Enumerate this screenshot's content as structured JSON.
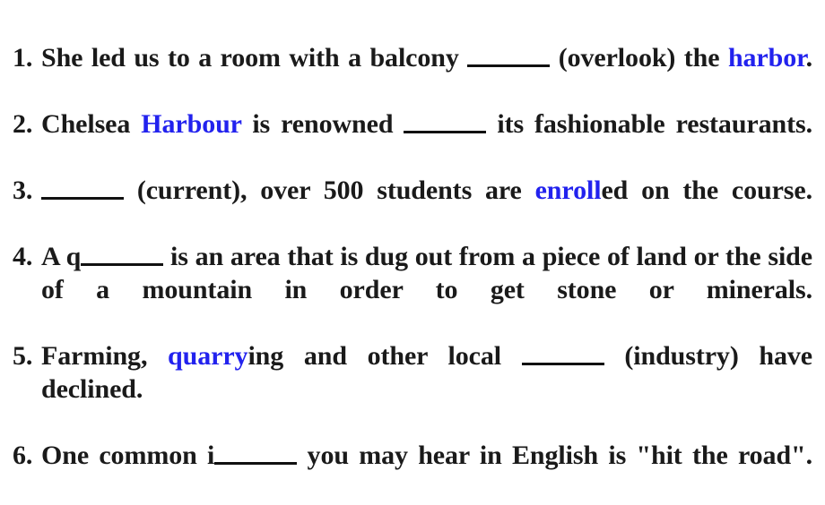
{
  "document": {
    "type": "fill-in-the-blank-worksheet",
    "accent_color": "#2222ee",
    "text_color": "#1a1a1a",
    "background_color": "#ffffff",
    "exercises": [
      {
        "number": "1.",
        "parts": [
          {
            "text": "She led us to a room with a balcony ",
            "style": "normal"
          },
          {
            "text": "",
            "style": "blank"
          },
          {
            "text": " (overlook) the ",
            "style": "normal"
          },
          {
            "text": "harbor",
            "style": "highlight"
          },
          {
            "text": ".",
            "style": "normal"
          }
        ],
        "plain_text": "She led us to a room with a balcony ______ (overlook) the harbor."
      },
      {
        "number": "2.",
        "parts": [
          {
            "text": "Chelsea ",
            "style": "normal"
          },
          {
            "text": "Harbour",
            "style": "highlight"
          },
          {
            "text": " is renowned ",
            "style": "normal"
          },
          {
            "text": "",
            "style": "blank"
          },
          {
            "text": " its fashionable restaurants.",
            "style": "normal"
          }
        ],
        "plain_text": "Chelsea Harbour is renowned ______ its fashionable restaurants."
      },
      {
        "number": "3.",
        "parts": [
          {
            "text": "",
            "style": "blank"
          },
          {
            "text": " (current), over 500 students are ",
            "style": "normal"
          },
          {
            "text": "enroll",
            "style": "highlight"
          },
          {
            "text": "ed on the course.",
            "style": "normal"
          }
        ],
        "plain_text": "______ (current), over 500 students are enrolled on the course."
      },
      {
        "number": "4.",
        "parts": [
          {
            "text": "A q",
            "style": "normal"
          },
          {
            "text": "",
            "style": "blank"
          },
          {
            "text": " is an area that is dug out from a piece of land or the side of a mountain in order to get stone or minerals.",
            "style": "normal"
          }
        ],
        "plain_text": "A q______ is an area that is dug out from a piece of land or the side of a mountain in order to get stone or minerals."
      },
      {
        "number": "5.",
        "parts": [
          {
            "text": "Farming, ",
            "style": "normal"
          },
          {
            "text": "quarry",
            "style": "highlight"
          },
          {
            "text": "ing and other local ",
            "style": "normal"
          },
          {
            "text": "",
            "style": "blank"
          },
          {
            "text": " (industry) have declined.",
            "style": "normal"
          }
        ],
        "plain_text": "Farming, quarrying and other local ______ (industry) have declined."
      },
      {
        "number": "6.",
        "parts": [
          {
            "text": "One common i",
            "style": "normal"
          },
          {
            "text": "",
            "style": "blank"
          },
          {
            "text": " you may hear in English is \"hit the road\".",
            "style": "normal"
          }
        ],
        "plain_text": "One common i______ you may hear in English is \"hit the road\"."
      }
    ]
  }
}
